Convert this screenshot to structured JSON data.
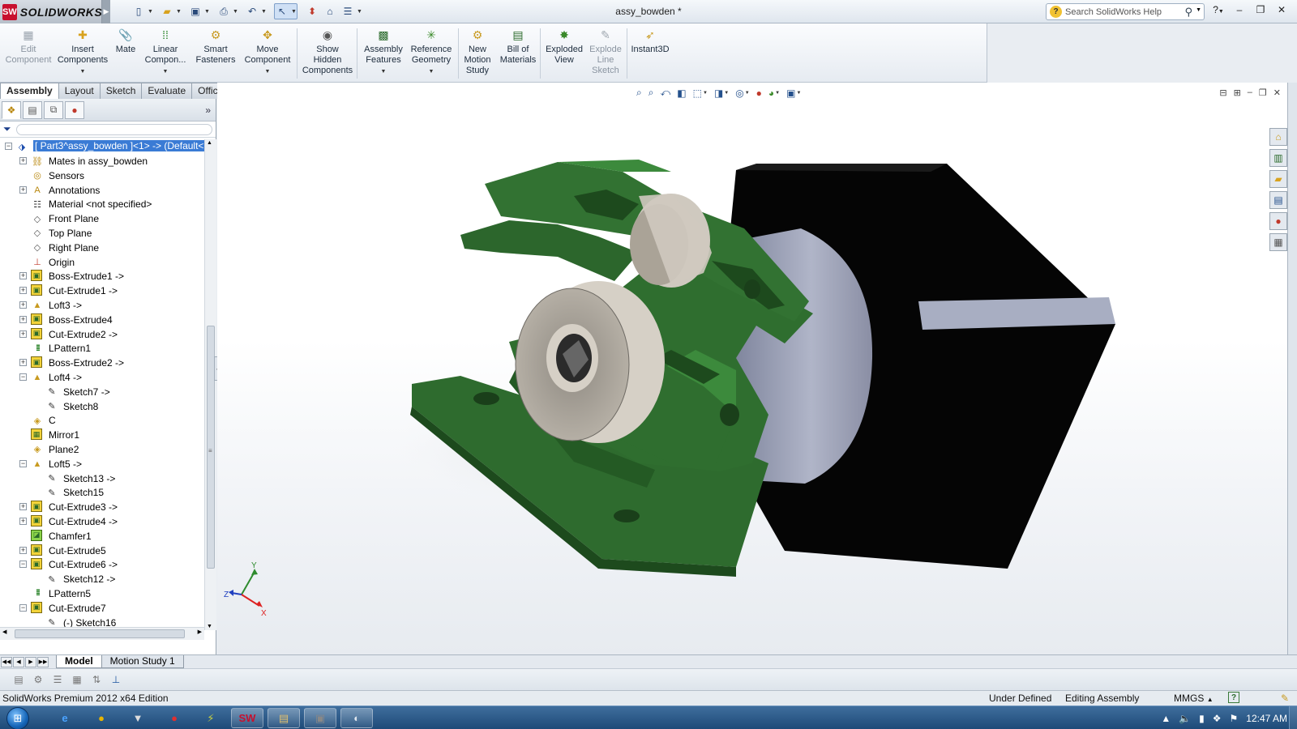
{
  "app": {
    "brand": "SOLIDWORKS",
    "logo_initials": "SW",
    "doc_title": "assy_bowden *"
  },
  "search": {
    "placeholder": "Search SolidWorks Help"
  },
  "command_manager": {
    "buttons": [
      {
        "label": "Edit\nComponent",
        "icon": "edit-component-icon",
        "enabled": false
      },
      {
        "label": "Insert\nComponents",
        "icon": "insert-components-icon",
        "enabled": true,
        "dropdown": true
      },
      {
        "label": "Mate",
        "icon": "mate-icon",
        "enabled": true
      },
      {
        "label": "Linear\nCompon...",
        "icon": "linear-pattern-icon",
        "enabled": true,
        "dropdown": true
      },
      {
        "label": "Smart\nFasteners",
        "icon": "smart-fasteners-icon",
        "enabled": true
      },
      {
        "label": "Move\nComponent",
        "icon": "move-component-icon",
        "enabled": true,
        "dropdown": true
      },
      {
        "label": "Show\nHidden\nComponents",
        "icon": "show-hidden-icon",
        "enabled": true
      },
      {
        "label": "Assembly\nFeatures",
        "icon": "assembly-features-icon",
        "enabled": true,
        "dropdown": true
      },
      {
        "label": "Reference\nGeometry",
        "icon": "reference-geometry-icon",
        "enabled": true,
        "dropdown": true
      },
      {
        "label": "New\nMotion\nStudy",
        "icon": "motion-study-icon",
        "enabled": true
      },
      {
        "label": "Bill of\nMaterials",
        "icon": "bom-icon",
        "enabled": true
      },
      {
        "label": "Exploded\nView",
        "icon": "exploded-view-icon",
        "enabled": true
      },
      {
        "label": "Explode\nLine\nSketch",
        "icon": "explode-line-sketch-icon",
        "enabled": false
      },
      {
        "label": "Instant3D",
        "icon": "instant3d-icon",
        "enabled": true
      }
    ],
    "tabs": [
      "Assembly",
      "Layout",
      "Sketch",
      "Evaluate",
      "Office Products"
    ],
    "active_tab": "Assembly"
  },
  "feature_tree": {
    "root_label": "[ Part3^assy_bowden ]<1> -> (Default<",
    "items": [
      {
        "label": "Mates in assy_bowden",
        "icon": "mates-folder-icon",
        "expand": "+",
        "level": 1
      },
      {
        "label": "Sensors",
        "icon": "sensors-icon",
        "expand": "",
        "level": 1
      },
      {
        "label": "Annotations",
        "icon": "annotations-icon",
        "expand": "+",
        "level": 1
      },
      {
        "label": "Material <not specified>",
        "icon": "material-icon",
        "expand": "",
        "level": 1
      },
      {
        "label": "Front Plane",
        "icon": "plane-icon",
        "expand": "",
        "level": 1
      },
      {
        "label": "Top Plane",
        "icon": "plane-icon",
        "expand": "",
        "level": 1
      },
      {
        "label": "Right Plane",
        "icon": "plane-icon",
        "expand": "",
        "level": 1
      },
      {
        "label": "Origin",
        "icon": "origin-icon",
        "expand": "",
        "level": 1
      },
      {
        "label": "Boss-Extrude1 ->",
        "icon": "boss-extrude-icon",
        "expand": "+",
        "level": 1
      },
      {
        "label": "Cut-Extrude1 ->",
        "icon": "cut-extrude-icon",
        "expand": "+",
        "level": 1
      },
      {
        "label": "Loft3 ->",
        "icon": "loft-icon",
        "expand": "+",
        "level": 1
      },
      {
        "label": "Boss-Extrude4",
        "icon": "boss-extrude-icon",
        "expand": "+",
        "level": 1
      },
      {
        "label": "Cut-Extrude2 ->",
        "icon": "cut-extrude-icon",
        "expand": "+",
        "level": 1
      },
      {
        "label": "LPattern1",
        "icon": "linear-pattern-icon",
        "expand": "",
        "level": 1
      },
      {
        "label": "Boss-Extrude2 ->",
        "icon": "boss-extrude-icon",
        "expand": "+",
        "level": 1
      },
      {
        "label": "Loft4 ->",
        "icon": "loft-icon",
        "expand": "-",
        "level": 1
      },
      {
        "label": "Sketch7 ->",
        "icon": "sketch-icon",
        "expand": "",
        "level": 2
      },
      {
        "label": "Sketch8",
        "icon": "sketch-icon",
        "expand": "",
        "level": 2
      },
      {
        "label": "C",
        "icon": "plane-feature-icon",
        "expand": "",
        "level": 1
      },
      {
        "label": "Mirror1",
        "icon": "mirror-icon",
        "expand": "",
        "level": 1
      },
      {
        "label": "Plane2",
        "icon": "plane-feature-icon",
        "expand": "",
        "level": 1
      },
      {
        "label": "Loft5 ->",
        "icon": "loft-icon",
        "expand": "-",
        "level": 1
      },
      {
        "label": "Sketch13 ->",
        "icon": "sketch-icon",
        "expand": "",
        "level": 2
      },
      {
        "label": "Sketch15",
        "icon": "sketch-icon",
        "expand": "",
        "level": 2
      },
      {
        "label": "Cut-Extrude3 ->",
        "icon": "cut-extrude-icon",
        "expand": "+",
        "level": 1
      },
      {
        "label": "Cut-Extrude4 ->",
        "icon": "cut-extrude-icon",
        "expand": "+",
        "level": 1
      },
      {
        "label": "Chamfer1",
        "icon": "chamfer-icon",
        "expand": "",
        "level": 1
      },
      {
        "label": "Cut-Extrude5",
        "icon": "cut-extrude-icon",
        "expand": "+",
        "level": 1
      },
      {
        "label": "Cut-Extrude6 ->",
        "icon": "cut-extrude-icon",
        "expand": "-",
        "level": 1
      },
      {
        "label": "Sketch12 ->",
        "icon": "sketch-icon",
        "expand": "",
        "level": 2
      },
      {
        "label": "LPattern5",
        "icon": "linear-pattern-icon",
        "expand": "",
        "level": 1
      },
      {
        "label": "Cut-Extrude7",
        "icon": "cut-extrude-icon",
        "expand": "-",
        "level": 1
      },
      {
        "label": "(-) Sketch16",
        "icon": "sketch-icon",
        "expand": "",
        "level": 2
      }
    ]
  },
  "bottom_tabs": {
    "items": [
      "Model",
      "Motion Study 1"
    ],
    "active": "Model"
  },
  "status_bar": {
    "edition": "SolidWorks Premium 2012 x64 Edition",
    "definition": "Under Defined",
    "mode": "Editing Assembly",
    "units": "MMGS",
    "help": "?"
  },
  "taskbar": {
    "clock": "12:47 AM",
    "apps": [
      {
        "name": "internet-explorer",
        "glyph": "e",
        "running": false
      },
      {
        "name": "chrome",
        "glyph": "●",
        "running": false
      },
      {
        "name": "app-3",
        "glyph": "▼",
        "running": false
      },
      {
        "name": "app-4",
        "glyph": "●",
        "running": false
      },
      {
        "name": "app-5",
        "glyph": "⚡",
        "running": false
      },
      {
        "name": "solidworks",
        "glyph": "SW",
        "running": true
      },
      {
        "name": "explorer",
        "glyph": "▤",
        "running": true
      },
      {
        "name": "app-8",
        "glyph": "▣",
        "running": true
      },
      {
        "name": "app-9",
        "glyph": "◐",
        "running": true
      }
    ]
  },
  "triad": {
    "x": "X",
    "y": "Y",
    "z": "Z"
  },
  "colors": {
    "bracket_green": "#2e6b2e",
    "bracket_green_dark": "#1d4a1d",
    "motor_black": "#050505",
    "motor_can": "#9ea2b4",
    "bearing": "#cfc9bf",
    "selection_blue": "#3a7bd5"
  }
}
